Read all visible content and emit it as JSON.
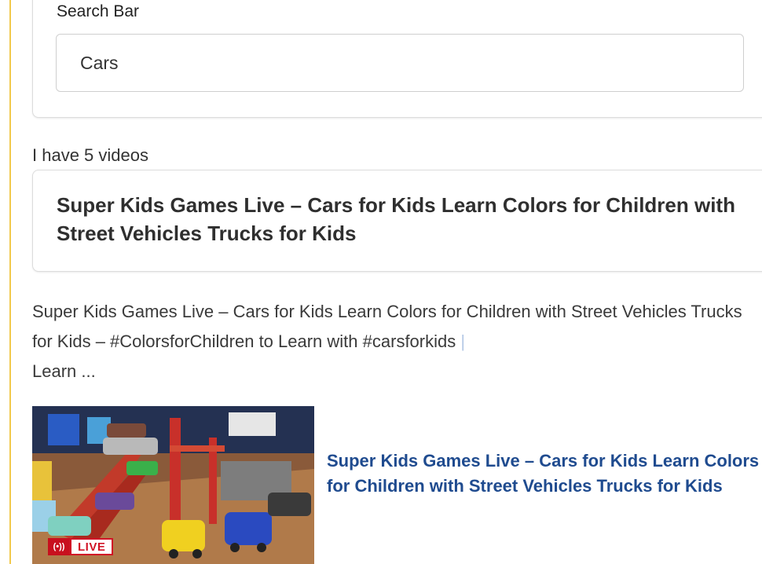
{
  "search": {
    "label": "Search Bar",
    "value": "Cars"
  },
  "results": {
    "count_text": "I have 5 videos"
  },
  "featured": {
    "title": "Super Kids Games Live – Cars for Kids Learn Colors for Children with Street Vehicles Trucks for Kids",
    "description_main": "Super Kids Games Live – Cars for Kids Learn Colors for Children with Street Vehicles Trucks for Kids – #ColorsforChildren to Learn with #carsforkids ",
    "description_pipe": "|",
    "description_end": "Learn ..."
  },
  "video": {
    "live_badge": "LIVE",
    "live_icon": "(•))",
    "title": "Super Kids Games Live – Cars for Kids Learn Colors for Children with Street Vehicles Trucks for Kids",
    "thumbnail_icon": "toy-cars-ramp-thumbnail"
  },
  "colors": {
    "accent_rule": "#f2c94c",
    "link": "#1f4b8f",
    "live_red": "#d11426"
  }
}
